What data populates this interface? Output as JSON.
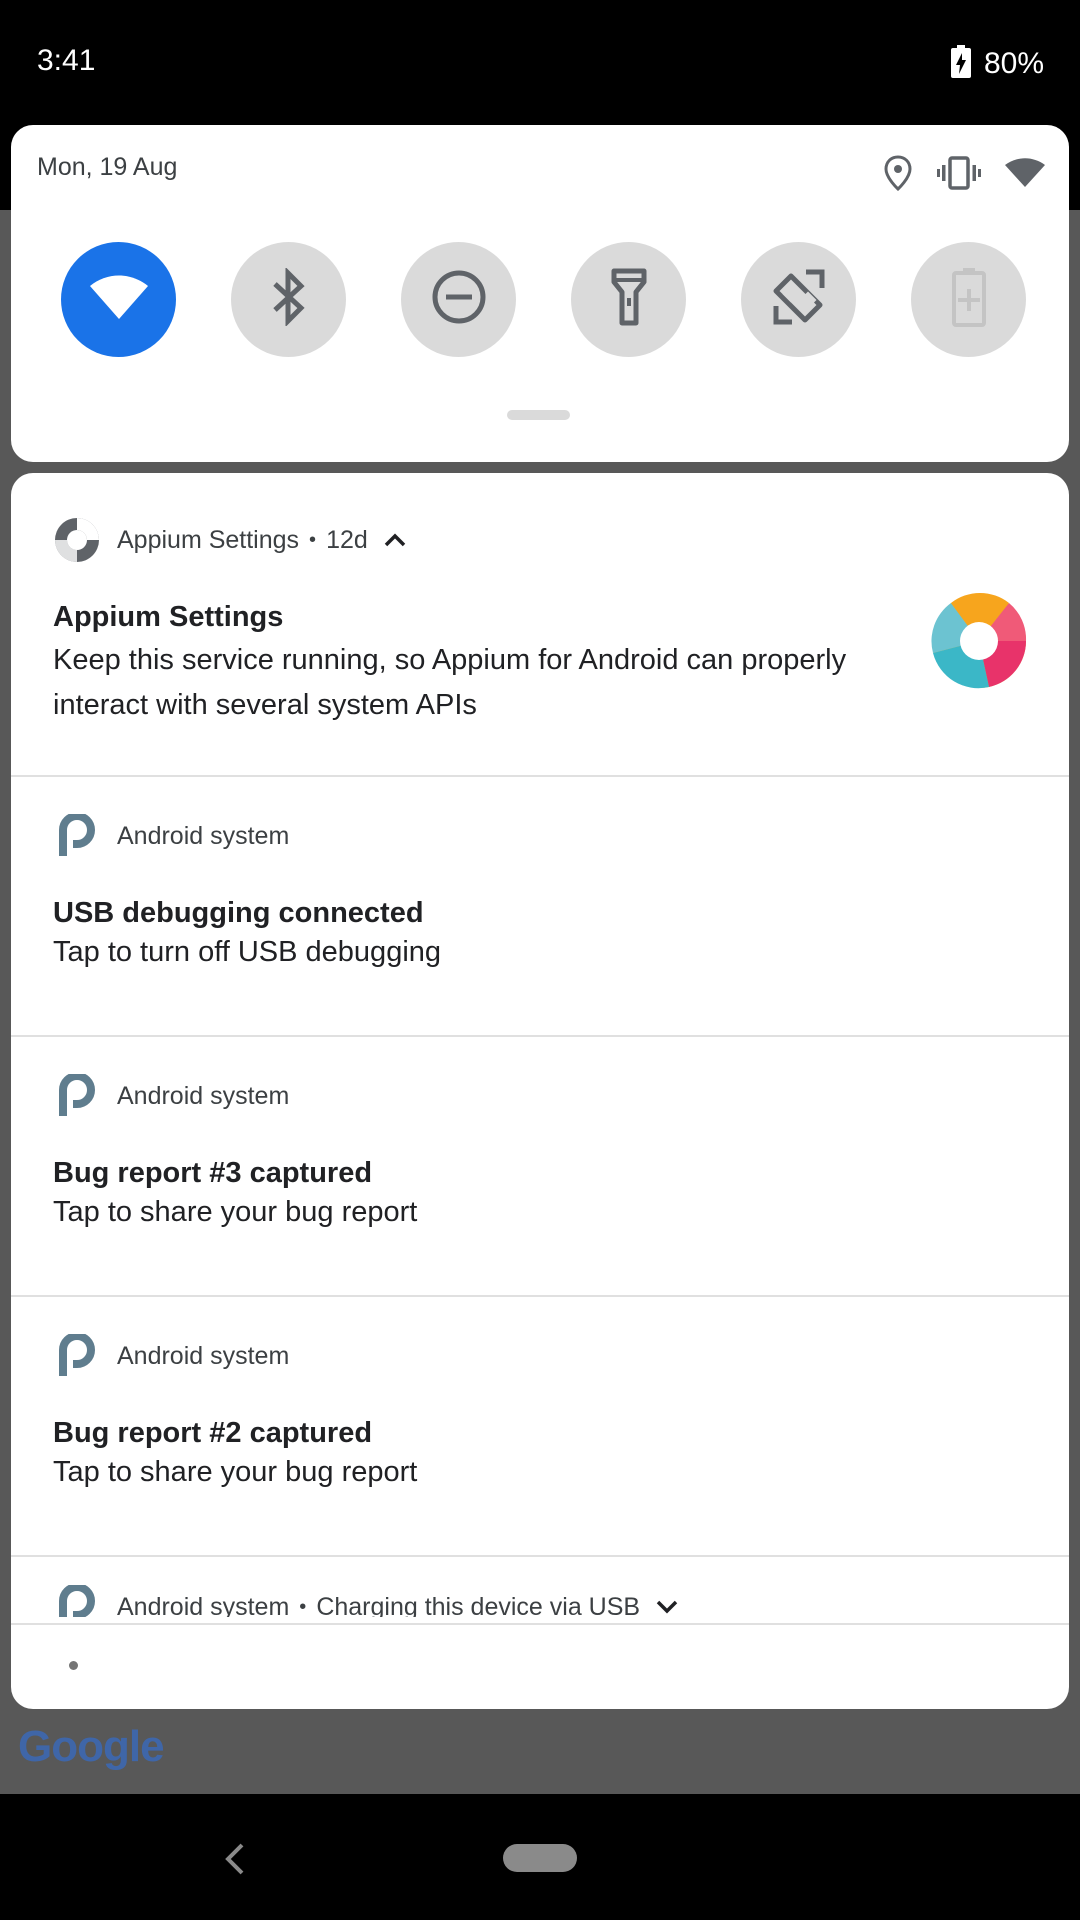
{
  "status_bar": {
    "time": "3:41",
    "battery_percent": "80%"
  },
  "quick_settings": {
    "date": "Mon, 19 Aug",
    "header_icons": [
      "location-icon",
      "vibrate-icon",
      "wifi-signal-icon"
    ],
    "tiles": [
      {
        "name": "wifi",
        "icon": "wifi-icon",
        "active": true
      },
      {
        "name": "bluetooth",
        "icon": "bluetooth-icon",
        "active": false
      },
      {
        "name": "do-not-disturb",
        "icon": "do-not-disturb-icon",
        "active": false
      },
      {
        "name": "flashlight",
        "icon": "flashlight-icon",
        "active": false
      },
      {
        "name": "auto-rotate",
        "icon": "auto-rotate-icon",
        "active": false
      },
      {
        "name": "battery-saver",
        "icon": "battery-saver-icon",
        "active": false
      }
    ]
  },
  "notifications": [
    {
      "app": "Appium Settings",
      "time": "12d",
      "title": "Appium Settings",
      "text": "Keep this service running, so Appium for Android can properly interact with several system APIs",
      "expanded": true
    },
    {
      "app": "Android system",
      "title": "USB debugging connected",
      "text": "Tap to turn off USB debugging"
    },
    {
      "app": "Android system",
      "title": "Bug report #3 captured",
      "text": "Tap to share your bug report"
    },
    {
      "app": "Android system",
      "title": "Bug report #2 captured",
      "text": "Tap to share your bug report"
    }
  ],
  "partial_notification": {
    "app": "Android system",
    "summary": "Charging this device via USB"
  },
  "background": {
    "search_logo_text": "Google"
  },
  "colors": {
    "accent": "#1a73e8",
    "tile_inactive": "#dadada",
    "system_icon": "#5f7d8e"
  }
}
